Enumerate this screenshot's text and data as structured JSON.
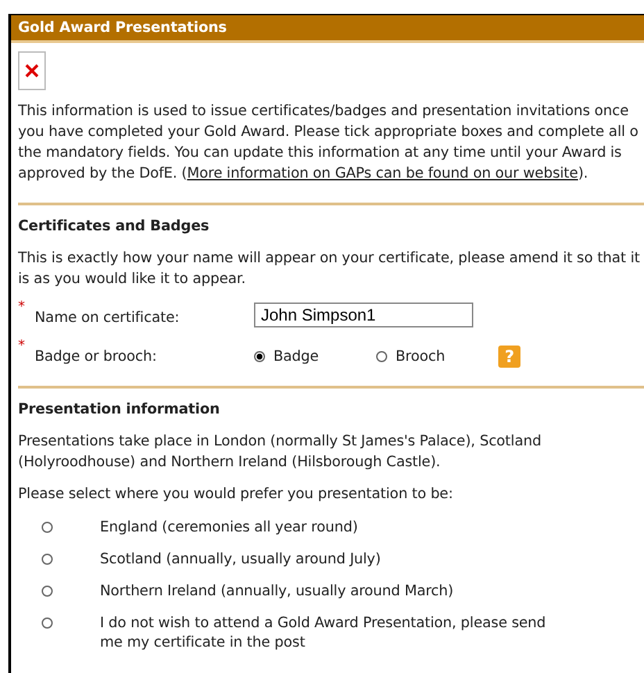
{
  "panel": {
    "title": "Gold Award Presentations",
    "intro": "This information is used to issue certificates/badges and presentation invitations once you have completed your Gold Award. Please tick appropriate boxes and complete all o the mandatory fields. You can update this information at any time until your Award is approved by the DofE. (",
    "intro_link": "More information on GAPs can be found on our website",
    "intro_end": ")."
  },
  "certificates": {
    "heading": "Certificates and Badges",
    "text": "This is exactly how your name will appear on your certificate, please amend it so that it is as you would like it to appear.",
    "name_field": {
      "marker": "*",
      "label": "Name on certificate:",
      "value": "John Simpson1"
    },
    "badge_field": {
      "marker": "*",
      "label": "Badge or brooch:",
      "options": [
        {
          "label": "Badge",
          "selected": true
        },
        {
          "label": "Brooch",
          "selected": false
        }
      ],
      "help": "?"
    }
  },
  "presentation": {
    "heading": "Presentation information",
    "text": "Presentations take place in London (normally St James's Palace), Scotland (Holyroodhouse) and Northern Ireland (Hilsborough Castle).",
    "prompt": "Please select where you would prefer you presentation to be:",
    "options": [
      {
        "label": "England (ceremonies all year round)",
        "selected": false
      },
      {
        "label": "Scotland (annually, usually around July)",
        "selected": false
      },
      {
        "label": "Northern Ireland (annually, usually around March)",
        "selected": false
      },
      {
        "label": "I do not wish to attend a Gold Award Presentation, please send me my certificate in the post",
        "selected": false
      }
    ]
  }
}
